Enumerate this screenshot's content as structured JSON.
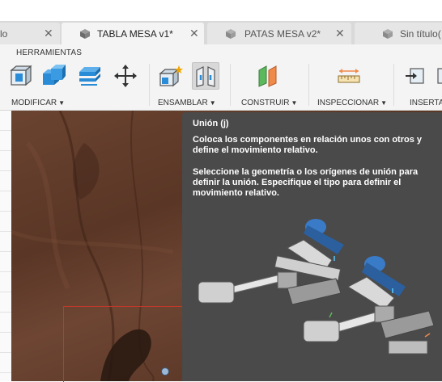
{
  "tabs": [
    {
      "label": "lo",
      "active": false
    },
    {
      "label": "TABLA MESA v1*",
      "active": true
    },
    {
      "label": "PATAS MESA v2*",
      "active": false
    },
    {
      "label": "Sin título(",
      "active": false
    }
  ],
  "toolbar": {
    "mode_label": "HERRAMIENTAS",
    "groups": {
      "modificar": "MODIFICAR",
      "ensamblar": "ENSAMBLAR",
      "construir": "CONSTRUIR",
      "inspeccionar": "INSPECCIONAR",
      "insertar": "INSERTA"
    }
  },
  "tooltip": {
    "title": "Unión (j)",
    "description": "Coloca los componentes en relación unos con otros y define el movimiento relativo.",
    "instructions": "Seleccione la geometría o los orígenes de unión para definir la unión. Especifique el tipo para definir el movimiento relativo."
  },
  "colors": {
    "tooltip_bg": "#4a4a4a",
    "wood": "#5a3626",
    "toolbar_bg": "#f4f4f4",
    "selection": "#c0392b"
  }
}
